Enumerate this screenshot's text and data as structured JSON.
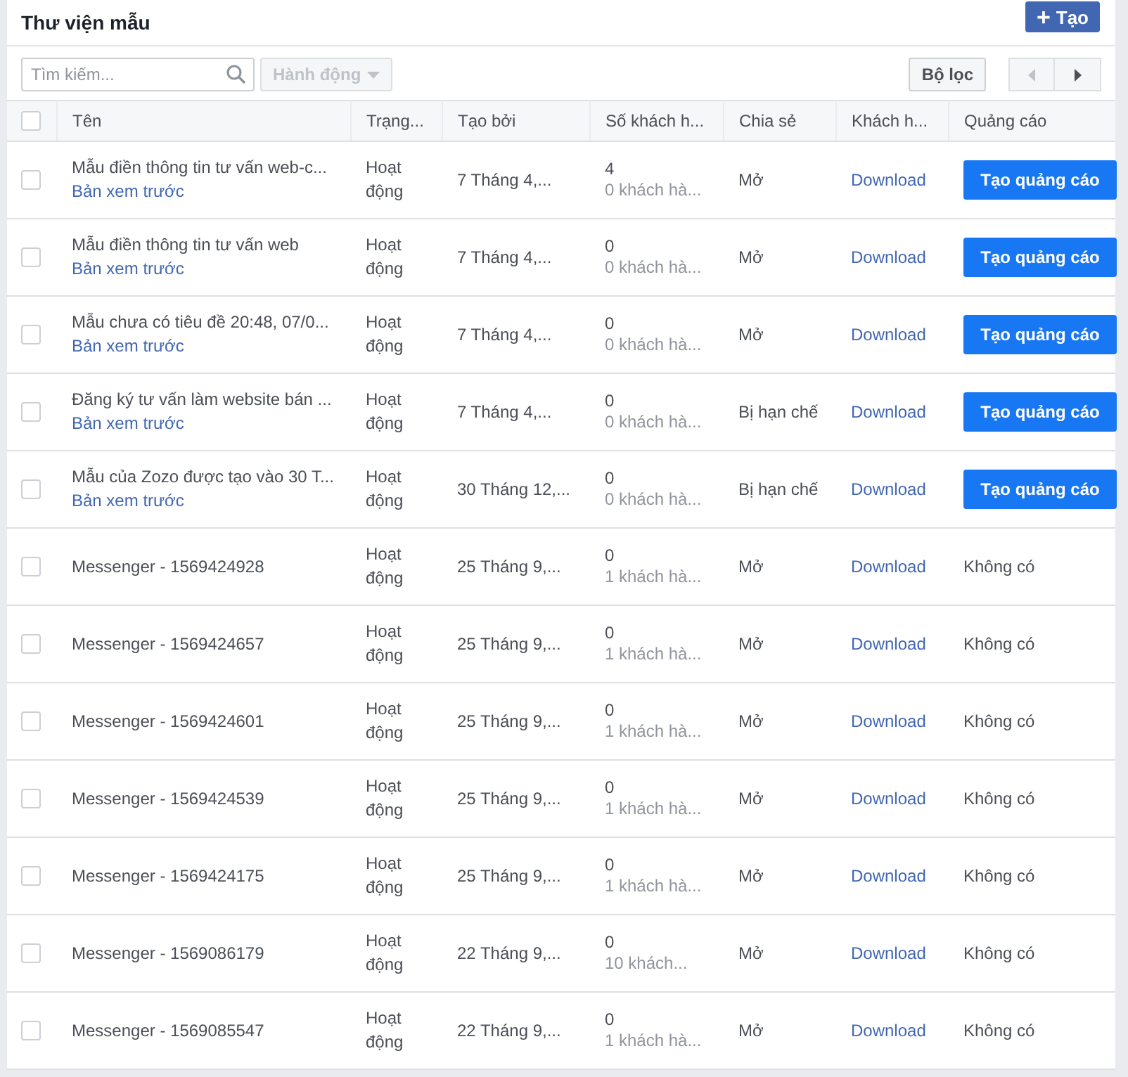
{
  "header": {
    "title": "Thư viện mẫu",
    "create_button": {
      "icon": "+",
      "label": "Tạo"
    }
  },
  "toolbar": {
    "search": {
      "placeholder": "Tìm kiếm..."
    },
    "actions": {
      "label": "Hành động",
      "disabled": true
    },
    "filter": {
      "label": "Bộ lọc"
    },
    "pager": {
      "prev_disabled": true,
      "next_disabled": false
    }
  },
  "table": {
    "select_all": {
      "checked": false
    },
    "columns": [
      "Tên",
      "Trạng...",
      "Tạo bởi",
      "Số khách h...",
      "Chia sẻ",
      "Khách h...",
      "Quảng cáo"
    ],
    "rows": [
      {
        "checked": false,
        "name": "Mẫu điền thông tin tư vấn web-c...",
        "preview": "Bản xem trước",
        "status": "Hoạt động",
        "created": "7 Tháng 4,...",
        "count": "4",
        "customers": "0 khách hà...",
        "sharing": "Mở",
        "download": "Download",
        "ad": {
          "kind": "button",
          "label": "Tạo quảng cáo"
        }
      },
      {
        "checked": false,
        "name": "Mẫu điền thông tin tư vấn web",
        "preview": "Bản xem trước",
        "status": "Hoạt động",
        "created": "7 Tháng 4,...",
        "count": "0",
        "customers": "0 khách hà...",
        "sharing": "Mở",
        "download": "Download",
        "ad": {
          "kind": "button",
          "label": "Tạo quảng cáo"
        }
      },
      {
        "checked": false,
        "name": "Mẫu chưa có tiêu đề 20:48, 07/0...",
        "preview": "Bản xem trước",
        "status": "Hoạt động",
        "created": "7 Tháng 4,...",
        "count": "0",
        "customers": "0 khách hà...",
        "sharing": "Mở",
        "download": "Download",
        "ad": {
          "kind": "button",
          "label": "Tạo quảng cáo"
        }
      },
      {
        "checked": false,
        "name": "Đăng ký tư vấn làm website bán ...",
        "preview": "Bản xem trước",
        "status": "Hoạt động",
        "created": "7 Tháng 4,...",
        "count": "0",
        "customers": "0 khách hà...",
        "sharing": "Bị hạn chế",
        "download": "Download",
        "ad": {
          "kind": "button",
          "label": "Tạo quảng cáo"
        }
      },
      {
        "checked": false,
        "name": "Mẫu của Zozo được tạo vào 30 T...",
        "preview": "Bản xem trước",
        "status": "Hoạt động",
        "created": "30 Tháng 12,...",
        "count": "0",
        "customers": "0 khách hà...",
        "sharing": "Bị hạn chế",
        "download": "Download",
        "ad": {
          "kind": "button",
          "label": "Tạo quảng cáo"
        }
      },
      {
        "checked": false,
        "name": "Messenger - 1569424928",
        "status": "Hoạt động",
        "created": "25 Tháng 9,...",
        "count": "0",
        "customers": "1 khách hà...",
        "sharing": "Mở",
        "download": "Download",
        "ad": {
          "kind": "text",
          "label": "Không có"
        }
      },
      {
        "checked": false,
        "name": "Messenger - 1569424657",
        "status": "Hoạt động",
        "created": "25 Tháng 9,...",
        "count": "0",
        "customers": "1 khách hà...",
        "sharing": "Mở",
        "download": "Download",
        "ad": {
          "kind": "text",
          "label": "Không có"
        }
      },
      {
        "checked": false,
        "name": "Messenger - 1569424601",
        "status": "Hoạt động",
        "created": "25 Tháng 9,...",
        "count": "0",
        "customers": "1 khách hà...",
        "sharing": "Mở",
        "download": "Download",
        "ad": {
          "kind": "text",
          "label": "Không có"
        }
      },
      {
        "checked": false,
        "name": "Messenger - 1569424539",
        "status": "Hoạt động",
        "created": "25 Tháng 9,...",
        "count": "0",
        "customers": "1 khách hà...",
        "sharing": "Mở",
        "download": "Download",
        "ad": {
          "kind": "text",
          "label": "Không có"
        }
      },
      {
        "checked": false,
        "name": "Messenger - 1569424175",
        "status": "Hoạt động",
        "created": "25 Tháng 9,...",
        "count": "0",
        "customers": "1 khách hà...",
        "sharing": "Mở",
        "download": "Download",
        "ad": {
          "kind": "text",
          "label": "Không có"
        }
      },
      {
        "checked": false,
        "name": "Messenger - 1569086179",
        "status": "Hoạt động",
        "created": "22 Tháng 9,...",
        "count": "0",
        "customers": "10 khách...",
        "sharing": "Mở",
        "download": "Download",
        "ad": {
          "kind": "text",
          "label": "Không có"
        }
      },
      {
        "checked": false,
        "name": "Messenger - 1569085547",
        "status": "Hoạt động",
        "created": "22 Tháng 9,...",
        "count": "0",
        "customers": "1 khách hà...",
        "sharing": "Mở",
        "download": "Download",
        "ad": {
          "kind": "text",
          "label": "Không có"
        }
      }
    ]
  }
}
